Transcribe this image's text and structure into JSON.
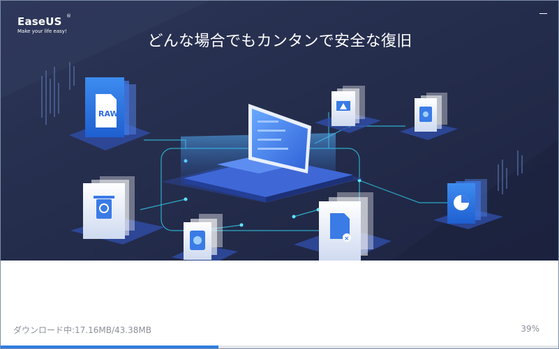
{
  "app": {
    "logo_name": "EaseUS",
    "logo_mark": "®",
    "logo_tagline": "Make your life easy!"
  },
  "hero": {
    "headline": "どんな場合でもカンタンで安全な復旧",
    "raw_label": "RAW",
    "icons": [
      "raw-file-icon",
      "recycle-bin-icon",
      "disk-icon",
      "document-delete-icon",
      "warning-monitor-icon",
      "disk-scan-icon",
      "pie-chart-icon",
      "laptop-icon"
    ]
  },
  "controls": {
    "minimize_icon": "minimize-icon"
  },
  "download": {
    "status": "ダウンロード中:17.16MB/43.38MB",
    "percent_label": "39%",
    "progress": 0.39
  },
  "colors": {
    "hero_bg": "#232b4a",
    "accent": "#2e7de1",
    "circuit": "#2fc4e0",
    "track": "#e4e7ec"
  }
}
